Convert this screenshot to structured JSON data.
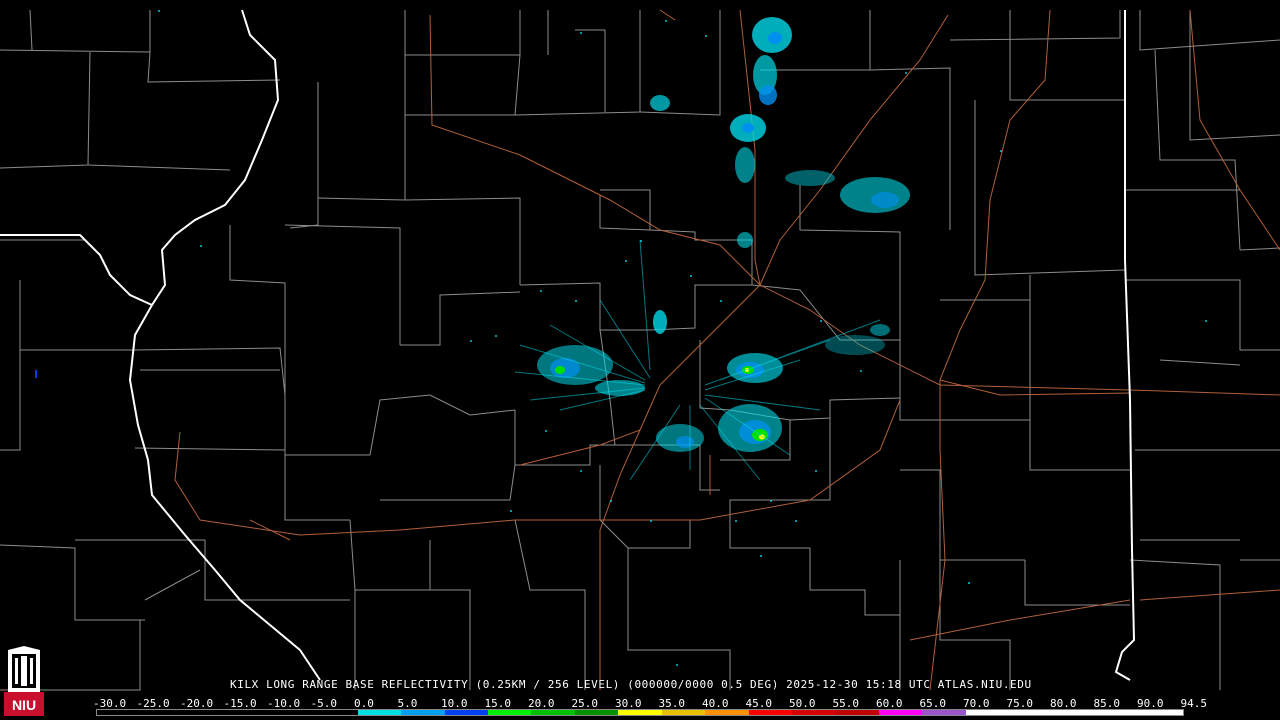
{
  "title": "KILX LONG RANGE BASE REFLECTIVITY (0.25KM / 256 LEVEL) (000000/0000 0.5 DEG) 2025-12-30 15:18 UTC  ATLAS.NIU.EDU",
  "logo_text": "NIU",
  "scale": {
    "labels": [
      "-30.0",
      "-25.0",
      "-20.0",
      "-15.0",
      "-10.0",
      "-5.0",
      "0.0",
      "5.0",
      "10.0",
      "15.0",
      "20.0",
      "25.0",
      "30.0",
      "35.0",
      "40.0",
      "45.0",
      "50.0",
      "55.0",
      "60.0",
      "65.0",
      "70.0",
      "75.0",
      "80.0",
      "85.0",
      "90.0",
      "94.5"
    ],
    "colors": [
      "#000000",
      "#000000",
      "#000000",
      "#000000",
      "#000000",
      "#000000",
      "#00e0e0",
      "#00a0f0",
      "#0040f0",
      "#00f000",
      "#00c000",
      "#009000",
      "#ffff00",
      "#e7c000",
      "#ff9000",
      "#ff0000",
      "#d60000",
      "#c00000",
      "#ff00ff",
      "#9955c9",
      "#ffffff",
      "#ffffff",
      "#ffffff",
      "#ffffff",
      "#ffffff"
    ]
  },
  "colors": {
    "background": "#000000",
    "county_lines": "#8c8c8c",
    "state_lines": "#ffffff",
    "roads": "#b0603a",
    "echo_light": "#00d8e8",
    "echo_medium": "#0090f0",
    "echo_heavy": "#00e000",
    "echo_core": "#ffff00"
  }
}
